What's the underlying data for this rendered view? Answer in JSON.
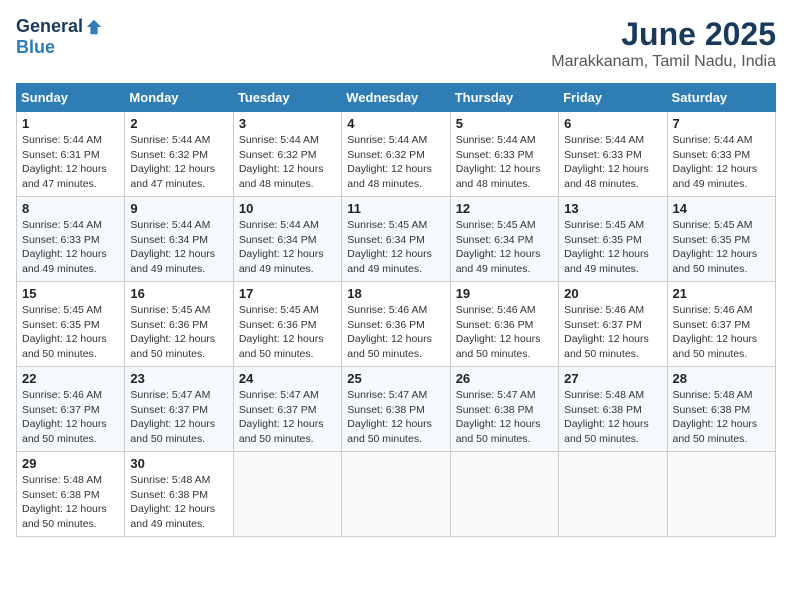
{
  "header": {
    "logo_general": "General",
    "logo_blue": "Blue",
    "month_title": "June 2025",
    "location": "Marakkanam, Tamil Nadu, India"
  },
  "weekdays": [
    "Sunday",
    "Monday",
    "Tuesday",
    "Wednesday",
    "Thursday",
    "Friday",
    "Saturday"
  ],
  "weeks": [
    [
      {
        "day": "1",
        "sunrise": "5:44 AM",
        "sunset": "6:31 PM",
        "daylight": "12 hours and 47 minutes."
      },
      {
        "day": "2",
        "sunrise": "5:44 AM",
        "sunset": "6:32 PM",
        "daylight": "12 hours and 47 minutes."
      },
      {
        "day": "3",
        "sunrise": "5:44 AM",
        "sunset": "6:32 PM",
        "daylight": "12 hours and 48 minutes."
      },
      {
        "day": "4",
        "sunrise": "5:44 AM",
        "sunset": "6:32 PM",
        "daylight": "12 hours and 48 minutes."
      },
      {
        "day": "5",
        "sunrise": "5:44 AM",
        "sunset": "6:33 PM",
        "daylight": "12 hours and 48 minutes."
      },
      {
        "day": "6",
        "sunrise": "5:44 AM",
        "sunset": "6:33 PM",
        "daylight": "12 hours and 48 minutes."
      },
      {
        "day": "7",
        "sunrise": "5:44 AM",
        "sunset": "6:33 PM",
        "daylight": "12 hours and 49 minutes."
      }
    ],
    [
      {
        "day": "8",
        "sunrise": "5:44 AM",
        "sunset": "6:33 PM",
        "daylight": "12 hours and 49 minutes."
      },
      {
        "day": "9",
        "sunrise": "5:44 AM",
        "sunset": "6:34 PM",
        "daylight": "12 hours and 49 minutes."
      },
      {
        "day": "10",
        "sunrise": "5:44 AM",
        "sunset": "6:34 PM",
        "daylight": "12 hours and 49 minutes."
      },
      {
        "day": "11",
        "sunrise": "5:45 AM",
        "sunset": "6:34 PM",
        "daylight": "12 hours and 49 minutes."
      },
      {
        "day": "12",
        "sunrise": "5:45 AM",
        "sunset": "6:34 PM",
        "daylight": "12 hours and 49 minutes."
      },
      {
        "day": "13",
        "sunrise": "5:45 AM",
        "sunset": "6:35 PM",
        "daylight": "12 hours and 49 minutes."
      },
      {
        "day": "14",
        "sunrise": "5:45 AM",
        "sunset": "6:35 PM",
        "daylight": "12 hours and 50 minutes."
      }
    ],
    [
      {
        "day": "15",
        "sunrise": "5:45 AM",
        "sunset": "6:35 PM",
        "daylight": "12 hours and 50 minutes."
      },
      {
        "day": "16",
        "sunrise": "5:45 AM",
        "sunset": "6:36 PM",
        "daylight": "12 hours and 50 minutes."
      },
      {
        "day": "17",
        "sunrise": "5:45 AM",
        "sunset": "6:36 PM",
        "daylight": "12 hours and 50 minutes."
      },
      {
        "day": "18",
        "sunrise": "5:46 AM",
        "sunset": "6:36 PM",
        "daylight": "12 hours and 50 minutes."
      },
      {
        "day": "19",
        "sunrise": "5:46 AM",
        "sunset": "6:36 PM",
        "daylight": "12 hours and 50 minutes."
      },
      {
        "day": "20",
        "sunrise": "5:46 AM",
        "sunset": "6:37 PM",
        "daylight": "12 hours and 50 minutes."
      },
      {
        "day": "21",
        "sunrise": "5:46 AM",
        "sunset": "6:37 PM",
        "daylight": "12 hours and 50 minutes."
      }
    ],
    [
      {
        "day": "22",
        "sunrise": "5:46 AM",
        "sunset": "6:37 PM",
        "daylight": "12 hours and 50 minutes."
      },
      {
        "day": "23",
        "sunrise": "5:47 AM",
        "sunset": "6:37 PM",
        "daylight": "12 hours and 50 minutes."
      },
      {
        "day": "24",
        "sunrise": "5:47 AM",
        "sunset": "6:37 PM",
        "daylight": "12 hours and 50 minutes."
      },
      {
        "day": "25",
        "sunrise": "5:47 AM",
        "sunset": "6:38 PM",
        "daylight": "12 hours and 50 minutes."
      },
      {
        "day": "26",
        "sunrise": "5:47 AM",
        "sunset": "6:38 PM",
        "daylight": "12 hours and 50 minutes."
      },
      {
        "day": "27",
        "sunrise": "5:48 AM",
        "sunset": "6:38 PM",
        "daylight": "12 hours and 50 minutes."
      },
      {
        "day": "28",
        "sunrise": "5:48 AM",
        "sunset": "6:38 PM",
        "daylight": "12 hours and 50 minutes."
      }
    ],
    [
      {
        "day": "29",
        "sunrise": "5:48 AM",
        "sunset": "6:38 PM",
        "daylight": "12 hours and 50 minutes."
      },
      {
        "day": "30",
        "sunrise": "5:48 AM",
        "sunset": "6:38 PM",
        "daylight": "12 hours and 49 minutes."
      },
      null,
      null,
      null,
      null,
      null
    ]
  ]
}
